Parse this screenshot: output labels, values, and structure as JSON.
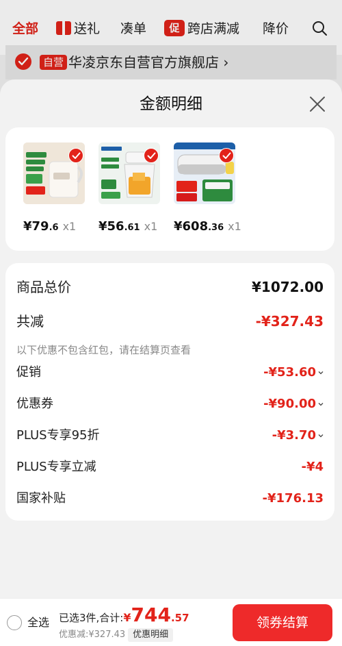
{
  "top_tabs": {
    "all": "全部",
    "gift": "送礼",
    "coudan": "凑单",
    "cu_badge": "促",
    "cross_store": "跨店满减",
    "price_drop": "降价"
  },
  "store": {
    "badge": "自营",
    "name": "华凌京东自营官方旗舰店",
    "chevron": "›"
  },
  "sheet": {
    "title": "金额明细"
  },
  "products": [
    {
      "price_int": "¥79",
      "price_dec": ".6",
      "qty": "x1"
    },
    {
      "price_int": "¥56",
      "price_dec": ".61",
      "qty": "x1"
    },
    {
      "price_int": "¥608",
      "price_dec": ".36",
      "qty": "x1"
    }
  ],
  "details": {
    "total_label": "商品总价",
    "total_value": "¥1072.00",
    "reduce_label": "共减",
    "reduce_value": "-¥327.43",
    "note": "以下优惠不包含红包，请在结算页查看",
    "items": [
      {
        "label": "促销",
        "value": "-¥53.60"
      },
      {
        "label": "优惠券",
        "value": "-¥90.00"
      },
      {
        "label": "PLUS专享95折",
        "value": "-¥3.70"
      },
      {
        "label": "PLUS专享立减",
        "value": "-¥4"
      },
      {
        "label": "国家补贴",
        "value": "-¥176.13"
      }
    ]
  },
  "bottom": {
    "select_all": "全选",
    "selected_text": "已选3件,合计:",
    "currency": "¥",
    "amount_int": "744",
    "amount_dec": ".57",
    "discount_text": "优惠减:¥327.43",
    "detail_tag": "优惠明细",
    "checkout": "领券结算"
  },
  "colors": {
    "accent": "#e2231a",
    "button": "#ee2a2a"
  }
}
